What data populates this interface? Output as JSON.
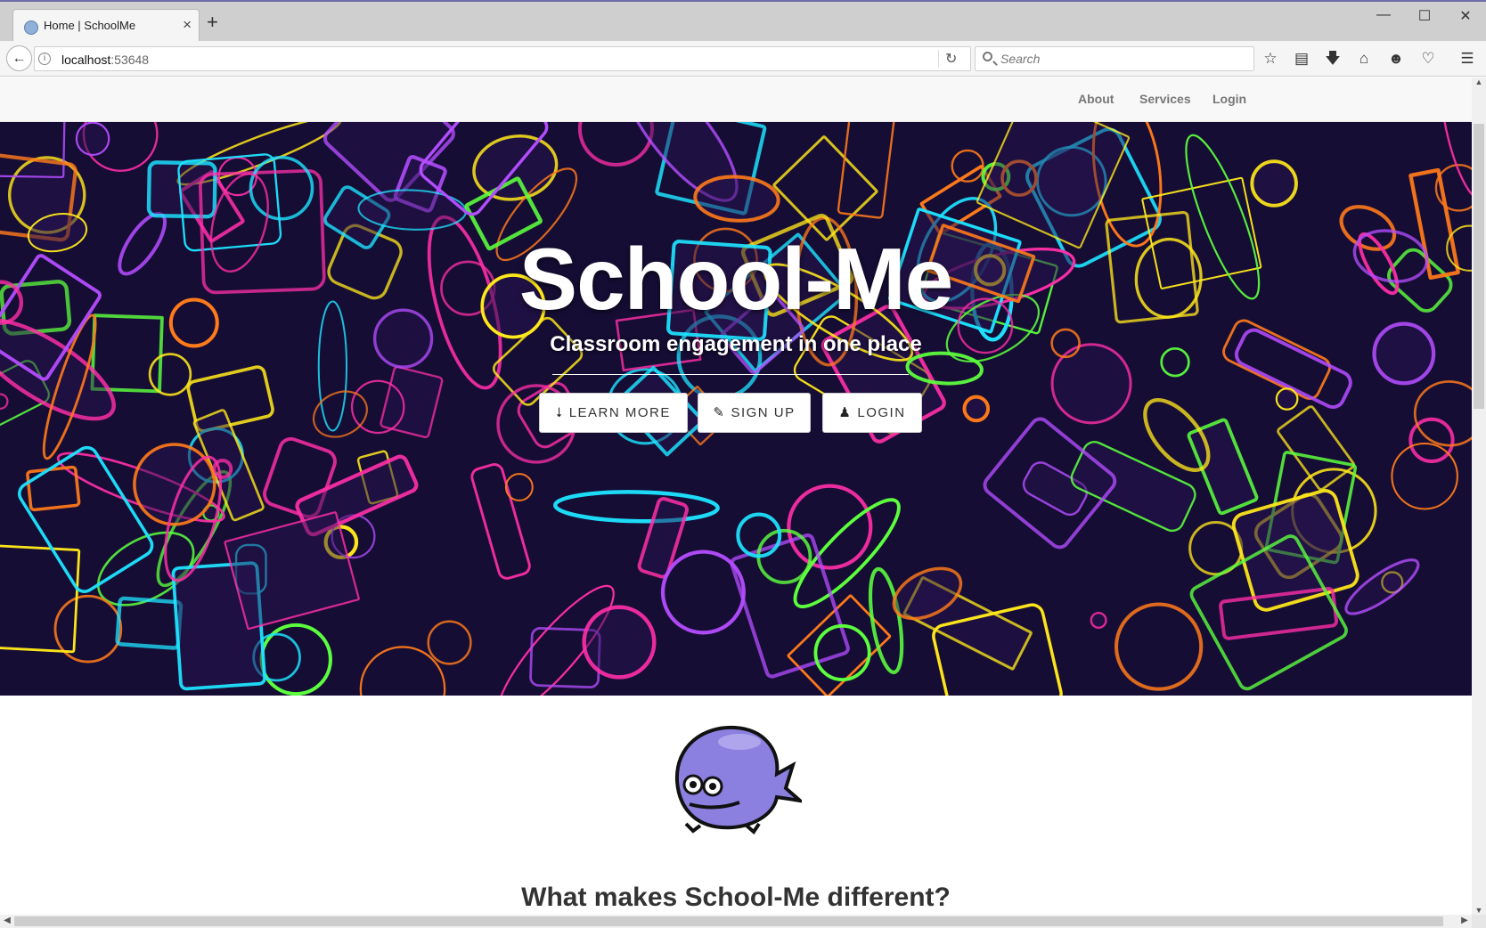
{
  "browser": {
    "tab_title": "Home | SchoolMe",
    "tab_close": "×",
    "new_tab": "+",
    "window_min": "—",
    "window_max": "☐",
    "window_close": "✕",
    "url_host": "localhost",
    "url_port": ":53648",
    "search_placeholder": "Search",
    "toolbar_icons": [
      "star-icon",
      "reading-list-icon",
      "download-icon",
      "home-icon",
      "sync-icon",
      "pocket-icon",
      "menu-icon"
    ]
  },
  "site_nav": {
    "items": [
      {
        "label": "About"
      },
      {
        "label": "Services"
      },
      {
        "label": "Login"
      }
    ]
  },
  "hero": {
    "title": "School-Me",
    "subtitle": "Classroom engagement in one place",
    "buttons": [
      {
        "label": "LEARN MORE",
        "icon": "bolt-icon"
      },
      {
        "label": "SIGN UP",
        "icon": "pencil-icon"
      },
      {
        "label": "LOGIN",
        "icon": "user-icon"
      }
    ]
  },
  "section": {
    "title": "What makes School-Me different?"
  },
  "colors": {
    "hero_bg": "#160d35",
    "neon": [
      "#ff2fa8",
      "#1ee3ff",
      "#ffe81a",
      "#5cff3d",
      "#ff7a1a",
      "#b44dff"
    ],
    "whale_body": "#8b80e0",
    "nav_text": "#777777"
  }
}
